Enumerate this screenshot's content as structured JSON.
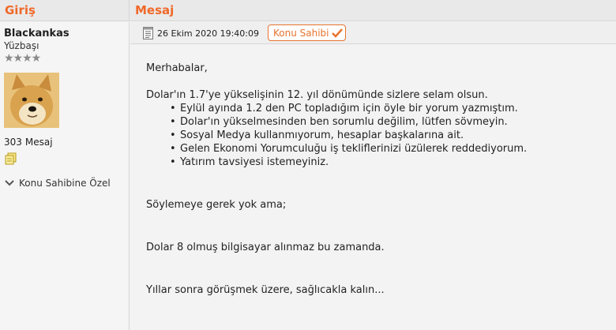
{
  "header": {
    "left_title": "Giriş",
    "right_title": "Mesaj"
  },
  "author": {
    "username": "Blackankas",
    "rank": "Yüzbaşı",
    "stars": "★★★★",
    "post_count": "303",
    "post_label": "Mesaj",
    "private_label": "Konu Sahibine Özel"
  },
  "post": {
    "date": "26 Ekim 2020 19:40:09",
    "owner_badge": "Konu Sahibi",
    "greeting": "Merhabalar,",
    "intro": "Dolar'ın 1.7'ye yükselişinin 12. yıl dönümünde sizlere selam olsun.",
    "bullets": [
      "Eylül ayında 1.2 den PC topladığım için öyle bir yorum yazmıştım.",
      "Dolar'ın yükselmesinden ben sorumlu değilim, lütfen sövmeyin.",
      "Sosyal Medya kullanmıyorum, hesaplar başkalarına ait.",
      "Gelen Ekonomi Yorumculuğu iş tekliflerinizi üzülerek reddediyorum.",
      "Yatırım tavsiyesi istemeyiniz."
    ],
    "line1": "Söylemeye gerek yok ama;",
    "line2": "Dolar 8 olmuş bilgisayar alınmaz bu zamanda.",
    "line3": "Yıllar sonra görüşmek üzere, sağlıcakla kalın..."
  },
  "colors": {
    "accent": "#f0692a",
    "badge": "#e8742e",
    "check": "#e8742e"
  },
  "icons": [
    "document-icon",
    "check-icon",
    "copy-quote-icon",
    "chevron-down-icon",
    "avatar-doge"
  ]
}
